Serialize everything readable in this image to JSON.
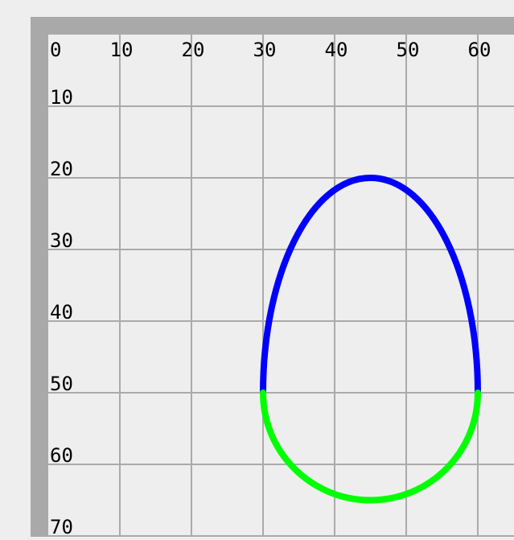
{
  "canvas": {
    "background": "#eeeeee",
    "frame_color": "#a9a9a9",
    "grid_color": "#aaaaaa"
  },
  "grid": {
    "x_ticks": [
      "0",
      "10",
      "20",
      "30",
      "40",
      "50",
      "60"
    ],
    "y_ticks": [
      "10",
      "20",
      "30",
      "40",
      "50",
      "60",
      "70"
    ]
  },
  "curve": {
    "top_arc": {
      "color": "#0000ff"
    },
    "bottom_arc": {
      "color": "#00ff00"
    },
    "points": {
      "left": [
        30,
        50
      ],
      "right": [
        60,
        50
      ],
      "top": [
        45,
        20
      ],
      "bottom": [
        45,
        65
      ]
    }
  }
}
